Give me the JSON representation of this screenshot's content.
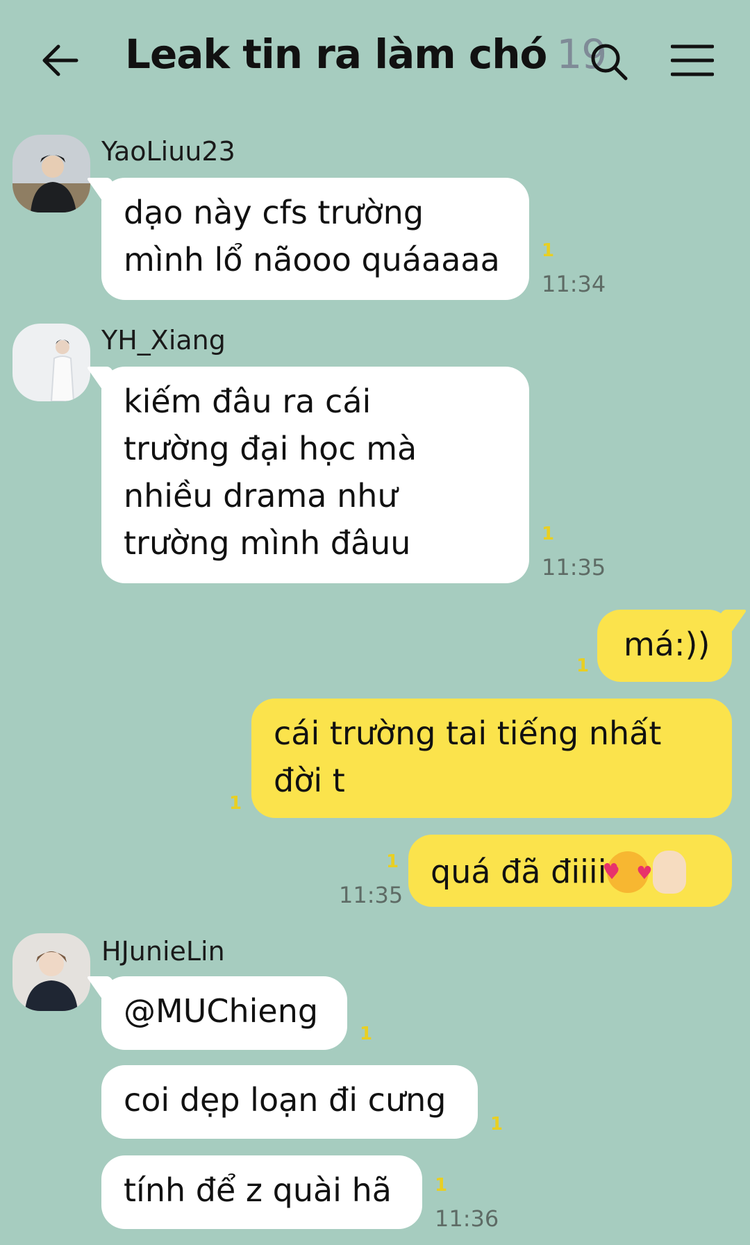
{
  "header": {
    "title": "Leak tin ra làm chó",
    "member_count": "19",
    "back_icon": "arrow-left-icon",
    "search_icon": "search-icon",
    "menu_icon": "hamburger-menu-icon"
  },
  "colors": {
    "background": "#a6ccbf",
    "incoming_bubble": "#ffffff",
    "outgoing_bubble": "#fbe34c",
    "unread": "#e8cf23"
  },
  "messages": [
    {
      "sender": "YaoLiuu23",
      "lines": [
        "dạo này cfs trường",
        "mình lổ nãooo quáaaaa"
      ],
      "unread": "1",
      "time": "11:34"
    },
    {
      "sender": "YH_Xiang",
      "lines": [
        "kiếm đâu ra cái",
        "trường đại học mà",
        "nhiều drama như",
        "trường mình đâuu"
      ],
      "unread": "1",
      "time": "11:35"
    },
    {
      "sender": "me",
      "lines": [
        "má:))"
      ],
      "unread": "1"
    },
    {
      "sender": "me",
      "lines": [
        "cái trường tai tiếng nhất",
        "đời t"
      ],
      "unread": "1"
    },
    {
      "sender": "me",
      "lines": [
        "quá đã điiii"
      ],
      "emojis": [
        "smiling-face-with-hearts",
        "rock-on-hand"
      ],
      "unread": "1",
      "time": "11:35"
    },
    {
      "sender": "HJunieLin",
      "lines": [
        "@MUChieng"
      ],
      "unread": "1"
    },
    {
      "sender": "HJunieLin",
      "lines": [
        "coi dẹp loạn đi cưng"
      ],
      "unread": "1"
    },
    {
      "sender": "HJunieLin",
      "lines": [
        "tính để z quài hã"
      ],
      "unread": "1",
      "time": "11:36"
    }
  ]
}
